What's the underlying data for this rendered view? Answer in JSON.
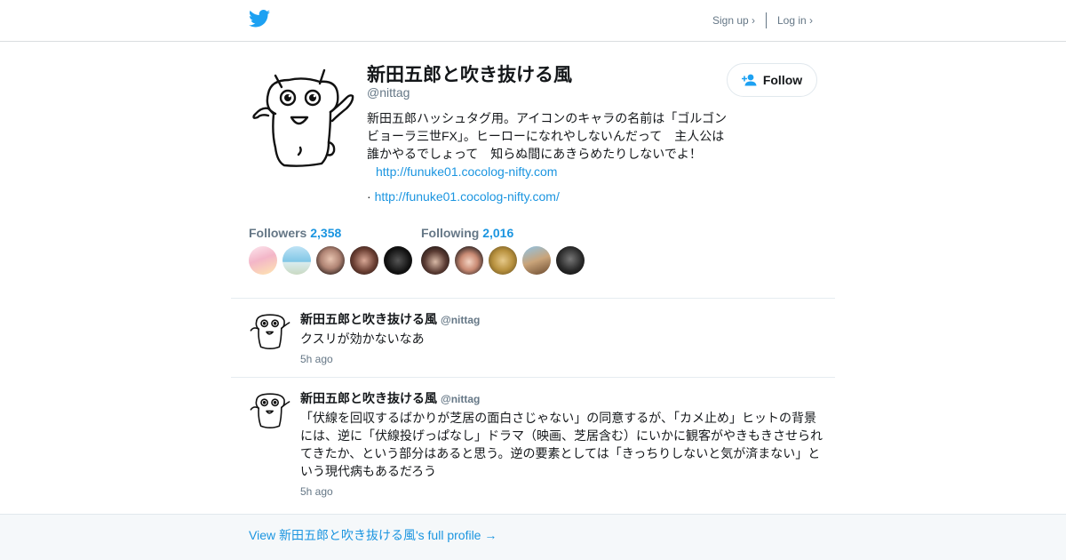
{
  "header": {
    "signup_label": "Sign up ›",
    "login_label": "Log in ›",
    "brand_color": "#1da1f2"
  },
  "profile": {
    "name": "新田五郎と吹き抜ける風",
    "handle": "@nittag",
    "follow_label": "Follow",
    "bio": "新田五郎ハッシュタグ用。アイコンのキャラの名前は「ゴルゴンビョーラ三世FX」。ヒーローになれやしないんだって　主人公は誰かやるでしょって　知らぬ間にあきらめたりしないでよ！",
    "bio_link": "http://funuke01.cocolog-nifty.com",
    "website_prefix": "·",
    "website": "http://funuke01.cocolog-nifty.com/",
    "followers_label": "Followers",
    "followers_count": "2,358",
    "following_label": "Following",
    "following_count": "2,016"
  },
  "tweets": [
    {
      "name": "新田五郎と吹き抜ける風",
      "handle": "@nittag",
      "text": "クスリが効かないなあ",
      "time": "5h ago"
    },
    {
      "name": "新田五郎と吹き抜ける風",
      "handle": "@nittag",
      "text": "「伏線を回収するばかりが芝居の面白さじゃない」の同意するが、「カメ止め」ヒットの背景には、逆に「伏線投げっぱなし」ドラマ（映画、芝居含む）にいかに観客がやきもきさせられてきたか、という部分はあると思う。逆の要素としては「きっちりしないと気が済まない」という現代病もあるだろう",
      "time": "5h ago"
    }
  ],
  "footer": {
    "link_label": "View 新田五郎と吹き抜ける風's full profile →"
  }
}
